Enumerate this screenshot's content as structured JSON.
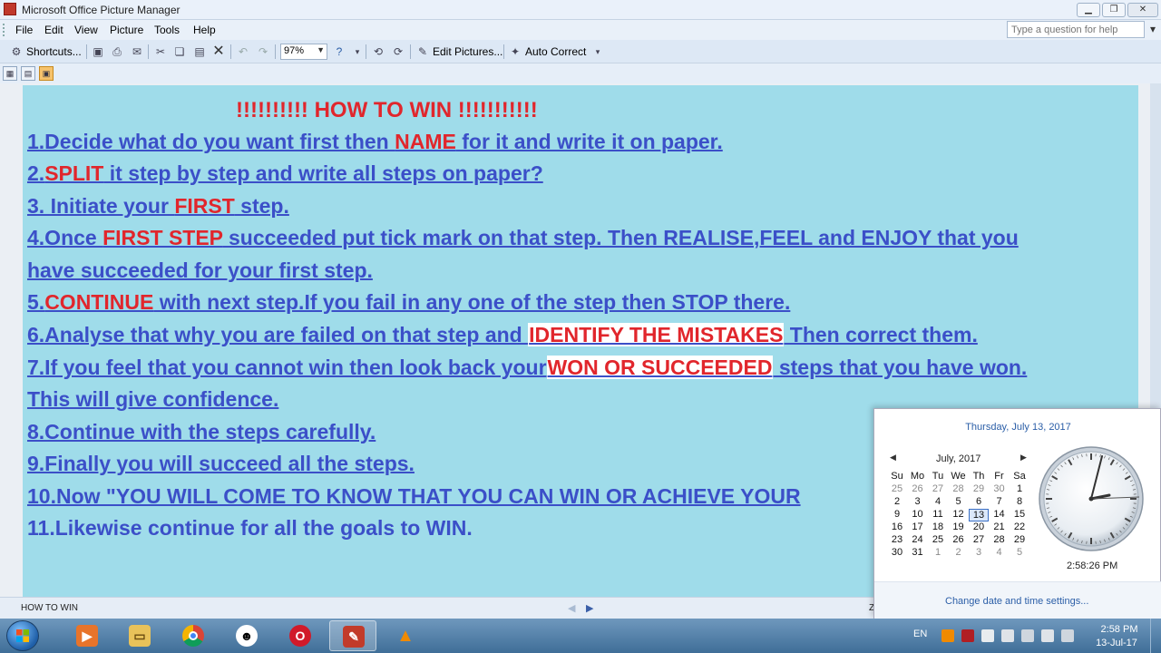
{
  "window": {
    "title": "Microsoft Office Picture Manager"
  },
  "menu": {
    "file": "File",
    "edit": "Edit",
    "view": "View",
    "picture": "Picture",
    "tools": "Tools",
    "help": "Help",
    "help_placeholder": "Type a question for help"
  },
  "toolbar": {
    "shortcuts": "Shortcuts...",
    "zoom": "97%",
    "edit_pictures": "Edit Pictures...",
    "auto_correct": "Auto Correct"
  },
  "picture": {
    "headline": "!!!!!!!!!! HOW TO WIN !!!!!!!!!!!",
    "l1a": "1.Decide what do you want first then ",
    "l1b": "NAME",
    "l1c": " for it and write it on paper.",
    "l2a": "2.",
    "l2b": "SPLIT",
    "l2c": " it step by step and write all steps on paper?",
    "l3a": "3. Initiate your ",
    "l3b": "FIRST",
    "l3c": " step.",
    "l4a": "4.Once ",
    "l4b": "FIRST STEP",
    "l4c": " succeeded put tick mark on that step. Then REALISE,FEEL and ENJOY that you",
    "l5": "have succeeded for your first step.",
    "l6a": "5.",
    "l6b": "CONTINUE",
    "l6c": " with next step.If you fail in any one of the step then STOP there.",
    "l7a": "6.Analyse that why you are failed on that step and ",
    "l7b": "IDENTIFY THE MISTAKES",
    "l7c": " Then correct them.",
    "l8a": "7.If you feel that you cannot win then look back your",
    "l8b": "WON OR SUCCEEDED",
    "l8c": "  steps that you have won.",
    "l9": "This will give confidence.",
    "l10": "8.Continue with the steps carefully.",
    "l11": "9.Finally you will succeed all the steps.",
    "l12": "10.Now \"YOU WILL COME TO KNOW THAT YOU CAN WIN OR ACHIEVE YOUR",
    "l13": "11.Likewise continue for all the goals to WIN."
  },
  "status": {
    "filename": "HOW TO WIN",
    "zoom_fragment": "Z"
  },
  "calendar": {
    "full_date": "Thursday, July 13, 2017",
    "month": "July, 2017",
    "weekdays": [
      "Su",
      "Mo",
      "Tu",
      "We",
      "Th",
      "Fr",
      "Sa"
    ],
    "weeks": [
      [
        "25",
        "26",
        "27",
        "28",
        "29",
        "30",
        "1"
      ],
      [
        "2",
        "3",
        "4",
        "5",
        "6",
        "7",
        "8"
      ],
      [
        "9",
        "10",
        "11",
        "12",
        "13",
        "14",
        "15"
      ],
      [
        "16",
        "17",
        "18",
        "19",
        "20",
        "21",
        "22"
      ],
      [
        "23",
        "24",
        "25",
        "26",
        "27",
        "28",
        "29"
      ],
      [
        "30",
        "31",
        "1",
        "2",
        "3",
        "4",
        "5"
      ]
    ],
    "selected_day": "13",
    "clock_time": "2:58:26 PM",
    "link": "Change date and time settings..."
  },
  "taskbar": {
    "lang": "EN",
    "time": "2:58 PM",
    "date": "13-Jul-17"
  },
  "colors": {
    "picture_bg": "#9fdcea",
    "text_blue": "#3b4fc8",
    "text_red": "#e1262c"
  }
}
